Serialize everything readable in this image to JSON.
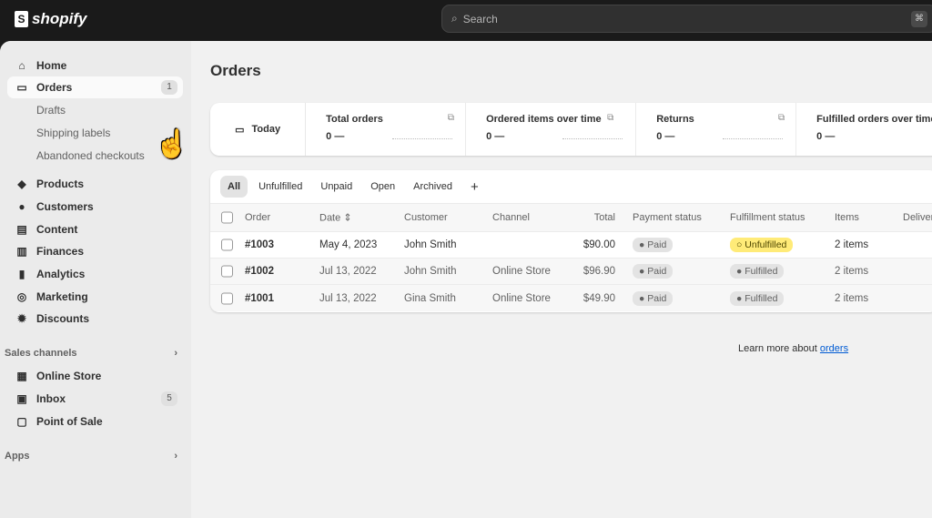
{
  "brand": "shopify",
  "search": {
    "placeholder": "Search",
    "shortcut": "⌘"
  },
  "sidebar": {
    "items": [
      {
        "label": "Home",
        "icon": "home-icon"
      },
      {
        "label": "Orders",
        "icon": "inbox-icon",
        "badge": "1"
      },
      {
        "label": "Drafts"
      },
      {
        "label": "Shipping labels"
      },
      {
        "label": "Abandoned checkouts"
      },
      {
        "label": "Products",
        "icon": "tag-icon"
      },
      {
        "label": "Customers",
        "icon": "person-icon"
      },
      {
        "label": "Content",
        "icon": "content-icon"
      },
      {
        "label": "Finances",
        "icon": "bank-icon"
      },
      {
        "label": "Analytics",
        "icon": "chart-icon"
      },
      {
        "label": "Marketing",
        "icon": "target-icon"
      },
      {
        "label": "Discounts",
        "icon": "discount-icon"
      }
    ],
    "sales_channels": "Sales channels",
    "channels": [
      {
        "label": "Online Store"
      },
      {
        "label": "Inbox",
        "badge": "5"
      },
      {
        "label": "Point of Sale"
      }
    ],
    "apps": "Apps"
  },
  "page": {
    "title": "Orders"
  },
  "metrics": {
    "date": "Today",
    "items": [
      {
        "title": "Total orders",
        "value": "0",
        "delta": "—"
      },
      {
        "title": "Ordered items over time",
        "value": "0",
        "delta": "—"
      },
      {
        "title": "Returns",
        "value": "0",
        "delta": "—"
      },
      {
        "title": "Fulfilled orders over time",
        "value": "0",
        "delta": "—"
      }
    ]
  },
  "tabs": [
    "All",
    "Unfulfilled",
    "Unpaid",
    "Open",
    "Archived",
    "+"
  ],
  "columns": [
    "Order",
    "Date",
    "Customer",
    "Channel",
    "Total",
    "Payment status",
    "Fulfillment status",
    "Items",
    "Delivery method"
  ],
  "orders": [
    {
      "order": "#1003",
      "date": "May 4, 2023",
      "customer": "John Smith",
      "channel": "",
      "total": "$90.00",
      "payment": "Paid",
      "fulfillment": "Unfulfilled",
      "items": "2 items"
    },
    {
      "order": "#1002",
      "date": "Jul 13, 2022",
      "customer": "John Smith",
      "channel": "Online Store",
      "total": "$96.90",
      "payment": "Paid",
      "fulfillment": "Fulfilled",
      "items": "2 items"
    },
    {
      "order": "#1001",
      "date": "Jul 13, 2022",
      "customer": "Gina Smith",
      "channel": "Online Store",
      "total": "$49.90",
      "payment": "Paid",
      "fulfillment": "Fulfilled",
      "items": "2 items"
    }
  ],
  "footer": {
    "text": "Learn more about ",
    "link": "orders"
  }
}
